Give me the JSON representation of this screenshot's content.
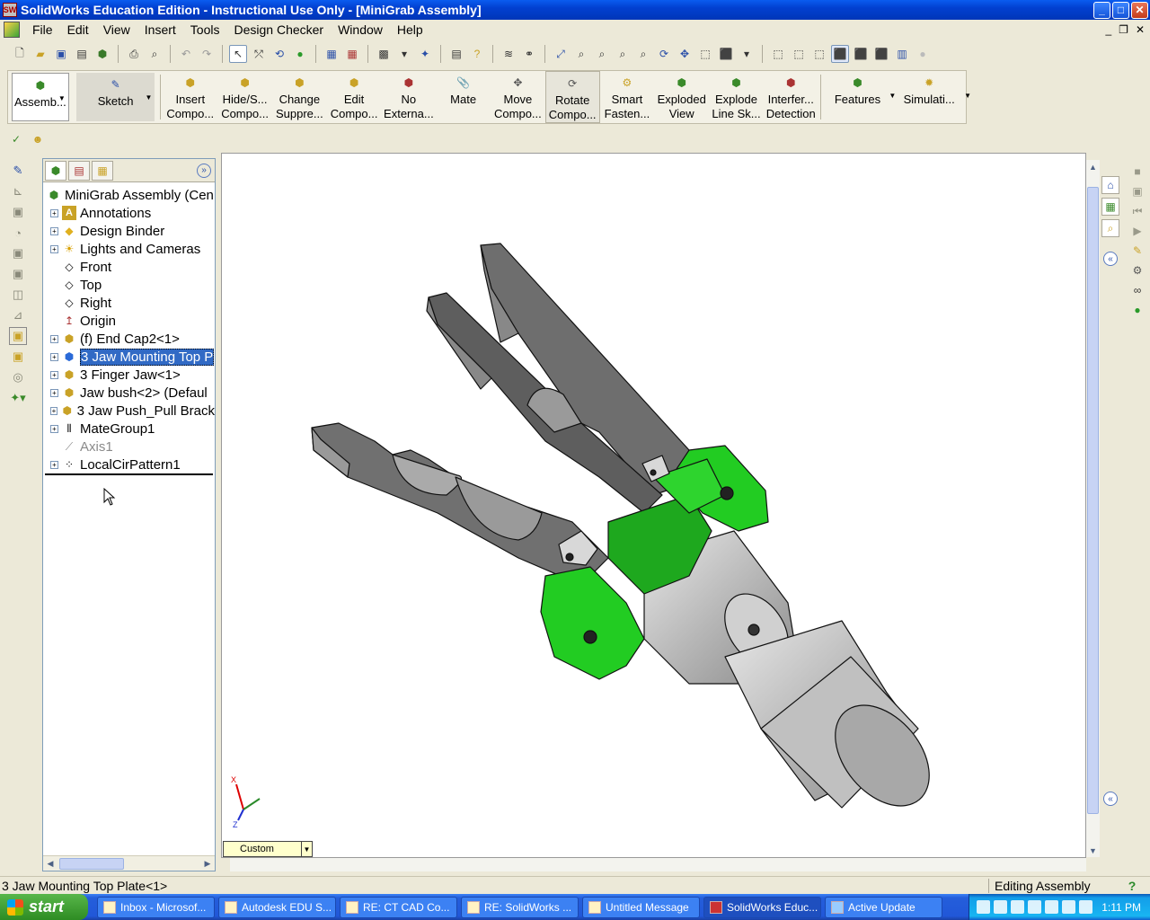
{
  "window": {
    "title": "SolidWorks Education Edition - Instructional Use Only - [MiniGrab Assembly]",
    "app_icon": "SW",
    "controls": [
      "_",
      "□",
      "✕"
    ]
  },
  "menu": {
    "items": [
      "File",
      "Edit",
      "View",
      "Insert",
      "Tools",
      "Design Checker",
      "Window",
      "Help"
    ],
    "doc_controls": [
      "_",
      "❐",
      "✕"
    ]
  },
  "command_manager": {
    "assembly_label": "Assemb...",
    "sketch_label": "Sketch",
    "buttons": [
      {
        "l1": "Insert",
        "l2": "Compo..."
      },
      {
        "l1": "Hide/S...",
        "l2": "Compo..."
      },
      {
        "l1": "Change",
        "l2": "Suppre..."
      },
      {
        "l1": "Edit",
        "l2": "Compo..."
      },
      {
        "l1": "No",
        "l2": "Externa..."
      },
      {
        "l1": "Mate",
        "l2": ""
      },
      {
        "l1": "Move",
        "l2": "Compo..."
      },
      {
        "l1": "Rotate",
        "l2": "Compo..."
      },
      {
        "l1": "Smart",
        "l2": "Fasten..."
      },
      {
        "l1": "Exploded",
        "l2": "View"
      },
      {
        "l1": "Explode",
        "l2": "Line Sk..."
      },
      {
        "l1": "Interfer...",
        "l2": "Detection"
      }
    ],
    "features_label": "Features",
    "simulation_label": "Simulati..."
  },
  "feature_tree": {
    "root": "MiniGrab Assembly  (Cen",
    "items": [
      {
        "label": "Annotations",
        "icon": "A",
        "expand": "+"
      },
      {
        "label": "Design Binder",
        "icon": "◆",
        "expand": "+"
      },
      {
        "label": "Lights and Cameras",
        "icon": "☀",
        "expand": "+"
      },
      {
        "label": "Front",
        "icon": "◇",
        "expand": ""
      },
      {
        "label": "Top",
        "icon": "◇",
        "expand": ""
      },
      {
        "label": "Right",
        "icon": "◇",
        "expand": ""
      },
      {
        "label": "Origin",
        "icon": "↥",
        "expand": ""
      },
      {
        "label": "(f) End Cap2<1>",
        "icon": "⬢",
        "expand": "+"
      },
      {
        "label": "3 Jaw Mounting Top P",
        "icon": "⬢",
        "expand": "+"
      },
      {
        "label": "3 Finger Jaw<1>",
        "icon": "⬢",
        "expand": "+"
      },
      {
        "label": "Jaw bush<2> (Defaul",
        "icon": "⬢",
        "expand": "+"
      },
      {
        "label": "3 Jaw Push_Pull Brack",
        "icon": "⬢",
        "expand": "+"
      },
      {
        "label": "MateGroup1",
        "icon": "⫴",
        "expand": "+"
      },
      {
        "label": "Axis1",
        "icon": "⟋",
        "expand": ""
      },
      {
        "label": "LocalCirPattern1",
        "icon": "⁘",
        "expand": "+"
      }
    ]
  },
  "graphics": {
    "view_orientation": "Custom",
    "triad": {
      "x": "X",
      "z": "Z"
    }
  },
  "status": {
    "selection": "3 Jaw Mounting Top Plate<1>",
    "mode": "Editing Assembly",
    "help": "?"
  },
  "taskbar": {
    "start_label": "start",
    "buttons": [
      "Inbox - Microsof...",
      "Autodesk EDU S...",
      "RE: CT CAD Co...",
      "RE: SolidWorks ...",
      "Untitled Message",
      "SolidWorks Educ...",
      "Active Update"
    ],
    "clock": "1:11 PM"
  },
  "colors": {
    "title_bar": "#0240d0",
    "selection": "#316ac5",
    "green_part": "#22cc22",
    "gray_part": "#6e6e6e"
  }
}
